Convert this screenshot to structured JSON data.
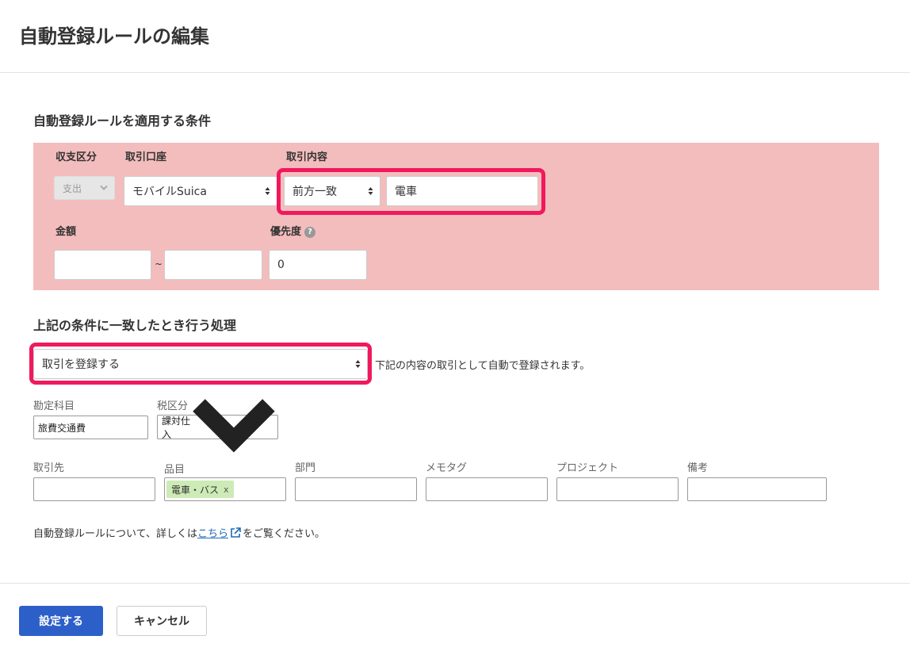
{
  "page_title": "自動登録ルールの編集",
  "conditions": {
    "section_title": "自動登録ルールを適用する条件",
    "type": {
      "label": "収支区分",
      "value": "支出"
    },
    "account": {
      "label": "取引口座",
      "value": "モバイルSuica"
    },
    "content": {
      "label": "取引内容",
      "match_value": "前方一致",
      "text_value": "電車"
    },
    "amount": {
      "label": "金額",
      "min_value": "",
      "max_value": "",
      "separator": "~"
    },
    "priority": {
      "label": "優先度",
      "value": "0",
      "help_icon": "question-icon"
    }
  },
  "action": {
    "section_title": "上記の条件に一致したとき行う処理",
    "process_value": "取引を登録する",
    "process_note": "下記の内容の取引として自動で登録されます。",
    "account_item": {
      "label": "勘定科目",
      "value": "旅費交通費"
    },
    "tax": {
      "label": "税区分",
      "value": "課対仕入"
    },
    "partner": {
      "label": "取引先",
      "value": ""
    },
    "item": {
      "label": "品目",
      "tag": "電車・バス",
      "tag_remove": "x"
    },
    "department": {
      "label": "部門",
      "value": ""
    },
    "memo_tag": {
      "label": "メモタグ",
      "value": ""
    },
    "project": {
      "label": "プロジェクト",
      "value": ""
    },
    "remarks": {
      "label": "備考",
      "value": ""
    }
  },
  "help_note": {
    "before": "自動登録ルールについて、詳しくは",
    "link": "こちら",
    "after": "をご覧ください。",
    "link_icon": "external-link-icon"
  },
  "footer": {
    "submit_label": "設定する",
    "cancel_label": "キャンセル"
  },
  "colors": {
    "condition_panel": "#f4bdbd",
    "highlight": "#f0195e",
    "primary_button": "#2d5fc9",
    "tag_bg": "#cdebb6",
    "link": "#1d6ab8"
  }
}
